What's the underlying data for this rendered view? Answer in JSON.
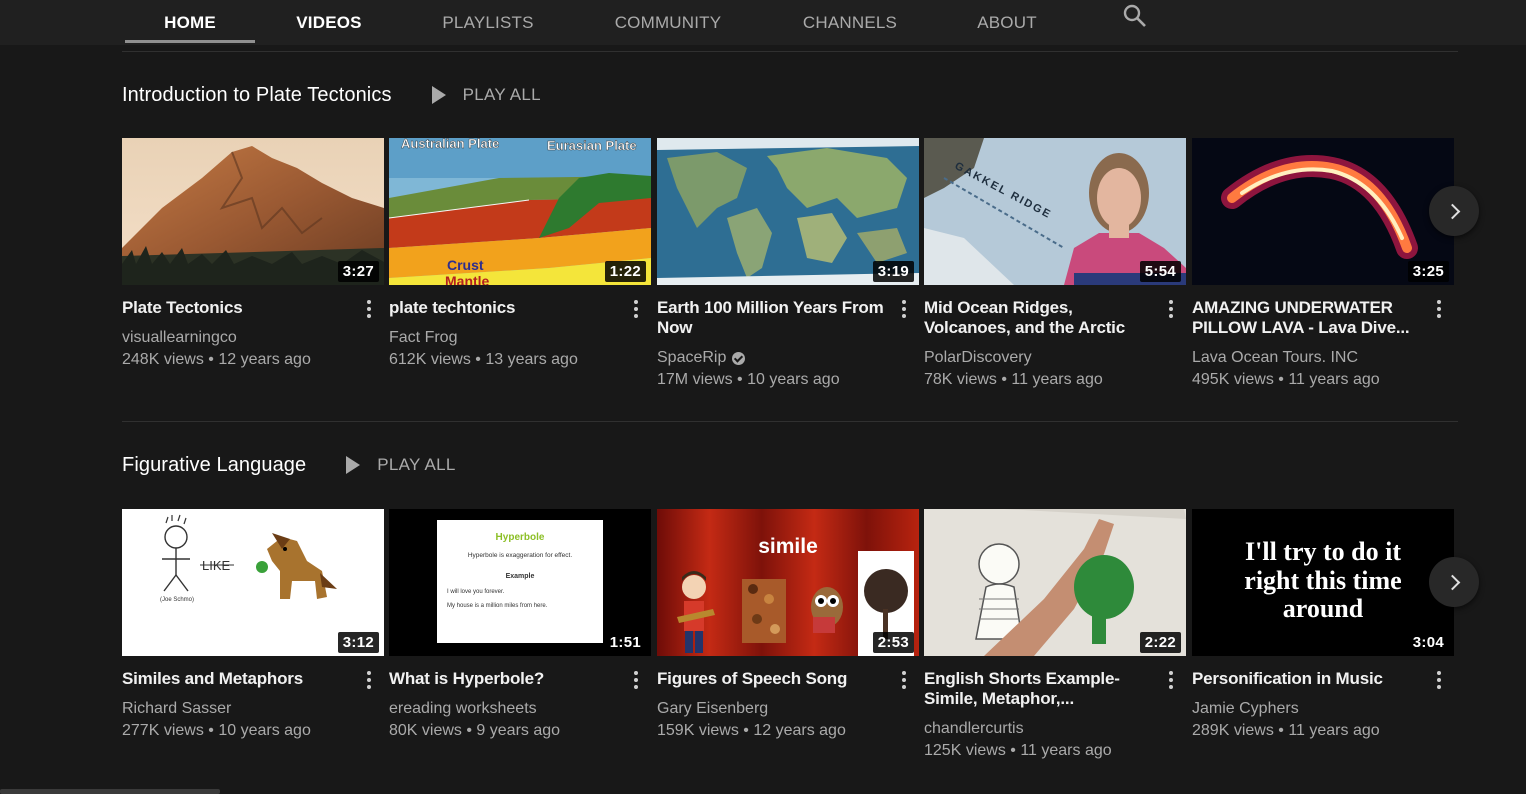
{
  "tabs": [
    {
      "label": "HOME",
      "active": true
    },
    {
      "label": "VIDEOS",
      "active": false
    },
    {
      "label": "PLAYLISTS",
      "active": false
    },
    {
      "label": "COMMUNITY",
      "active": false
    },
    {
      "label": "CHANNELS",
      "active": false
    },
    {
      "label": "ABOUT",
      "active": false
    }
  ],
  "search_icon": "search-icon",
  "shelves": [
    {
      "title": "Introduction to Plate Tectonics",
      "play_all": "PLAY ALL",
      "videos": [
        {
          "title": "Plate Tectonics",
          "channel": "visuallearningco",
          "views": "248K views",
          "age": "12 years ago",
          "duration": "3:27",
          "verified": false
        },
        {
          "title": "plate techtonics",
          "channel": "Fact Frog",
          "views": "612K views",
          "age": "13 years ago",
          "duration": "1:22",
          "verified": false
        },
        {
          "title": "Earth 100 Million Years From Now",
          "channel": "SpaceRip",
          "views": "17M views",
          "age": "10 years ago",
          "duration": "3:19",
          "verified": true
        },
        {
          "title": "Mid Ocean Ridges, Volcanoes, and the Arctic",
          "channel": "PolarDiscovery",
          "views": "78K views",
          "age": "11 years ago",
          "duration": "5:54",
          "verified": false
        },
        {
          "title": "AMAZING UNDERWATER PILLOW LAVA - Lava Dive...",
          "channel": "Lava Ocean Tours. INC",
          "views": "495K views",
          "age": "11 years ago",
          "duration": "3:25",
          "verified": false
        }
      ]
    },
    {
      "title": "Figurative Language",
      "play_all": "PLAY ALL",
      "videos": [
        {
          "title": "Similes and Metaphors",
          "channel": "Richard Sasser",
          "views": "277K views",
          "age": "10 years ago",
          "duration": "3:12",
          "verified": false
        },
        {
          "title": "What is Hyperbole?",
          "channel": "ereading worksheets",
          "views": "80K views",
          "age": "9 years ago",
          "duration": "1:51",
          "verified": false
        },
        {
          "title": "Figures of Speech Song",
          "channel": "Gary Eisenberg",
          "views": "159K views",
          "age": "12 years ago",
          "duration": "2:53",
          "verified": false
        },
        {
          "title": "English Shorts Example- Simile, Metaphor,...",
          "channel": "chandlercurtis",
          "views": "125K views",
          "age": "11 years ago",
          "duration": "2:22",
          "verified": false
        },
        {
          "title": "Personification in Music",
          "channel": "Jamie Cyphers",
          "views": "289K views",
          "age": "11 years ago",
          "duration": "3:04",
          "verified": false
        }
      ]
    }
  ],
  "thumb_text": {
    "australian_plate": "Australian Plate",
    "eurasian_plate": "Eurasian Plate",
    "crust": "Crust",
    "mantle": "Mantle",
    "gakkel_ridge": "GAKKEL RIDGE",
    "like": "LIKE",
    "stick_name": "(Joe Schmo)",
    "hyperbole_heading": "Hyperbole",
    "hyperbole_def": "Hyperbole is exaggeration for effect.",
    "hyperbole_example": "Example",
    "hyperbole_line1": "I will love you forever.",
    "hyperbole_line2": "My house is a million miles from here.",
    "simile": "simile",
    "lyric_line1": "I'll try to do it",
    "lyric_line2": "right this time",
    "lyric_line3": "around"
  },
  "colors": {
    "background": "#181818",
    "tabbar": "#202020",
    "muted_text": "#aaaaaa"
  }
}
